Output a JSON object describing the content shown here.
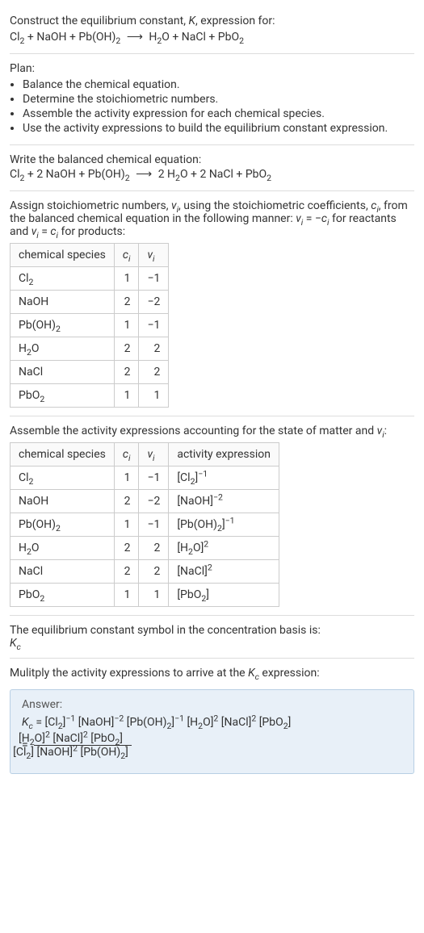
{
  "header": {
    "title_html": "Construct the equilibrium constant, <span class='italic'>K</span>, expression for:",
    "reaction_html": "Cl<sub>2</sub> + NaOH + Pb(OH)<sub>2</sub> <span class='arrow'>⟶</span> H<sub>2</sub>O + NaCl + PbO<sub>2</sub>"
  },
  "plan": {
    "label": "Plan:",
    "items": [
      "Balance the chemical equation.",
      "Determine the stoichiometric numbers.",
      "Assemble the activity expression for each chemical species.",
      "Use the activity expressions to build the equilibrium constant expression."
    ]
  },
  "balanced": {
    "label": "Write the balanced chemical equation:",
    "reaction_html": "Cl<sub>2</sub> + 2 NaOH + Pb(OH)<sub>2</sub> <span class='arrow'>⟶</span> 2 H<sub>2</sub>O + 2 NaCl + PbO<sub>2</sub>"
  },
  "stoich": {
    "intro_html": "Assign stoichiometric numbers, <span class='italic'>ν<sub>i</sub></span>, using the stoichiometric coefficients, <span class='italic'>c<sub>i</sub></span>, from the balanced chemical equation in the following manner: <span class='italic'>ν<sub>i</sub></span> = −<span class='italic'>c<sub>i</sub></span> for reactants and <span class='italic'>ν<sub>i</sub></span> = <span class='italic'>c<sub>i</sub></span> for products:",
    "headers": [
      "chemical species",
      "c_i",
      "ν_i"
    ],
    "header_html": [
      "chemical species",
      "<span class='italic'>c<sub>i</sub></span>",
      "<span class='italic'>ν<sub>i</sub></span>"
    ],
    "rows": [
      {
        "species_html": "Cl<sub>2</sub>",
        "c": "1",
        "v": "−1"
      },
      {
        "species_html": "NaOH",
        "c": "2",
        "v": "−2"
      },
      {
        "species_html": "Pb(OH)<sub>2</sub>",
        "c": "1",
        "v": "−1"
      },
      {
        "species_html": "H<sub>2</sub>O",
        "c": "2",
        "v": "2"
      },
      {
        "species_html": "NaCl",
        "c": "2",
        "v": "2"
      },
      {
        "species_html": "PbO<sub>2</sub>",
        "c": "1",
        "v": "1"
      }
    ]
  },
  "activity": {
    "intro_html": "Assemble the activity expressions accounting for the state of matter and <span class='italic'>ν<sub>i</sub></span>:",
    "headers": [
      "chemical species",
      "c_i",
      "ν_i",
      "activity expression"
    ],
    "header_html": [
      "chemical species",
      "<span class='italic'>c<sub>i</sub></span>",
      "<span class='italic'>ν<sub>i</sub></span>",
      "activity expression"
    ],
    "rows": [
      {
        "species_html": "Cl<sub>2</sub>",
        "c": "1",
        "v": "−1",
        "act_html": "[Cl<sub>2</sub>]<sup>−1</sup>"
      },
      {
        "species_html": "NaOH",
        "c": "2",
        "v": "−2",
        "act_html": "[NaOH]<sup>−2</sup>"
      },
      {
        "species_html": "Pb(OH)<sub>2</sub>",
        "c": "1",
        "v": "−1",
        "act_html": "[Pb(OH)<sub>2</sub>]<sup>−1</sup>"
      },
      {
        "species_html": "H<sub>2</sub>O",
        "c": "2",
        "v": "2",
        "act_html": "[H<sub>2</sub>O]<sup>2</sup>"
      },
      {
        "species_html": "NaCl",
        "c": "2",
        "v": "2",
        "act_html": "[NaCl]<sup>2</sup>"
      },
      {
        "species_html": "PbO<sub>2</sub>",
        "c": "1",
        "v": "1",
        "act_html": "[PbO<sub>2</sub>]"
      }
    ]
  },
  "symbol": {
    "label": "The equilibrium constant symbol in the concentration basis is:",
    "value_html": "<span class='italic'>K<sub>c</sub></span>"
  },
  "multiply": {
    "label_html": "Mulitply the activity expressions to arrive at the <span class='italic'>K<sub>c</sub></span> expression:"
  },
  "answer": {
    "label": "Answer:",
    "line1_html": "<span class='italic'>K<sub>c</sub></span> = [Cl<sub>2</sub>]<sup>−1</sup> [NaOH]<sup>−2</sup> [Pb(OH)<sub>2</sub>]<sup>−1</sup> [H<sub>2</sub>O]<sup>2</sup> [NaCl]<sup>2</sup> [PbO<sub>2</sub>]",
    "frac_num_html": "[H<sub>2</sub>O]<sup>2</sup> [NaCl]<sup>2</sup> [PbO<sub>2</sub>]",
    "frac_den_html": "[Cl<sub>2</sub>] [NaOH]<sup>2</sup> [Pb(OH)<sub>2</sub>]"
  },
  "chart_data": {
    "type": "table",
    "tables": [
      {
        "title": "Stoichiometric numbers",
        "columns": [
          "chemical species",
          "c_i",
          "ν_i"
        ],
        "rows": [
          [
            "Cl2",
            1,
            -1
          ],
          [
            "NaOH",
            2,
            -2
          ],
          [
            "Pb(OH)2",
            1,
            -1
          ],
          [
            "H2O",
            2,
            2
          ],
          [
            "NaCl",
            2,
            2
          ],
          [
            "PbO2",
            1,
            1
          ]
        ]
      },
      {
        "title": "Activity expressions",
        "columns": [
          "chemical species",
          "c_i",
          "ν_i",
          "activity expression"
        ],
        "rows": [
          [
            "Cl2",
            1,
            -1,
            "[Cl2]^-1"
          ],
          [
            "NaOH",
            2,
            -2,
            "[NaOH]^-2"
          ],
          [
            "Pb(OH)2",
            1,
            -1,
            "[Pb(OH)2]^-1"
          ],
          [
            "H2O",
            2,
            2,
            "[H2O]^2"
          ],
          [
            "NaCl",
            2,
            2,
            "[NaCl]^2"
          ],
          [
            "PbO2",
            1,
            1,
            "[PbO2]"
          ]
        ]
      }
    ]
  }
}
